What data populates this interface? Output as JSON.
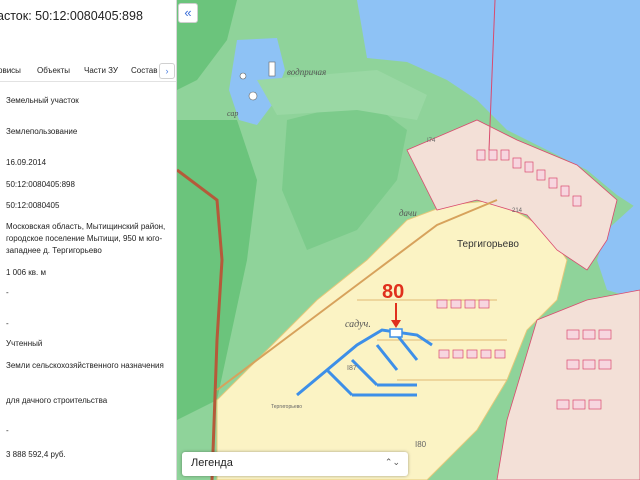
{
  "panel": {
    "title": "асток: 50:12:0080405:898",
    "tabs": [
      "рвисы",
      "Объекты",
      "Части ЗУ",
      "Состав"
    ],
    "more_label": "›",
    "fields": [
      "Земельный участок",
      "Землепользование",
      "16.09.2014",
      "50:12:0080405:898",
      "50:12:0080405",
      "Московская область, Мытищинский район, городское поселение Мытищи, 950 м юго-западнее д. Тергигорьево",
      "1 006 кв. м",
      "-",
      "-",
      "Учтенный",
      "Земли сельскохозяйственного назначения",
      "для дачного строительства",
      "-",
      "3 888 592,4 руб."
    ]
  },
  "map": {
    "collapse_label": "«",
    "legend_label": "Легенда",
    "legend_chevron": "⌃⌄",
    "labels": {
      "village": "Тергигорьево",
      "marker_number": "80",
      "gardens": "садуч.",
      "dacha": "дачи",
      "water": "водпричая",
      "small_sar": "сар",
      "small_terg": "Тергигорьево",
      "p187": "I87",
      "p180": "I80",
      "p174": "I74",
      "p214": "214"
    },
    "colors": {
      "water": "#8ec2f5",
      "forest": "#6bc47c",
      "meadow": "#8fd39a",
      "settlement": "#fbf3c4",
      "parcel_red": "#d94a6e",
      "highlight": "#3d8fe8",
      "marker": "#e0301e"
    }
  }
}
